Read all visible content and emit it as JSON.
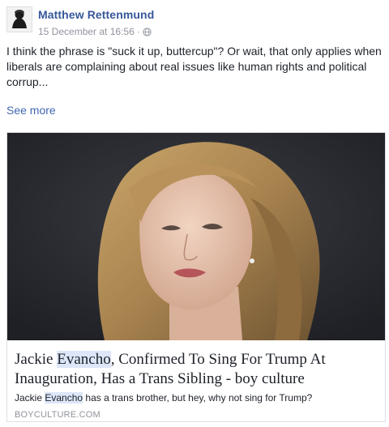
{
  "post": {
    "author": "Matthew Rettenmund",
    "timestamp": "15 December at 16:56",
    "separator": "·",
    "privacy_icon": "globe-icon",
    "text": "I think the phrase is \"suck it up, buttercup\"? Or wait, that only applies when liberals are complaining about real issues like human rights and political corrup...",
    "see_more": "See more"
  },
  "link_card": {
    "title_pre": "Jackie ",
    "title_highlight": "Evancho",
    "title_post": ", Confirmed To Sing For Trump At Inauguration, Has a Trans Sibling - boy culture",
    "desc_pre": "Jackie ",
    "desc_highlight": "Evancho",
    "desc_post": " has a trans brother, but hey, why not sing for Trump?",
    "domain": "BOYCULTURE.COM"
  },
  "colors": {
    "author_link": "#365899",
    "see_more_link": "#4267b2",
    "meta_gray": "#90949c",
    "highlight": "#dce6f8"
  }
}
